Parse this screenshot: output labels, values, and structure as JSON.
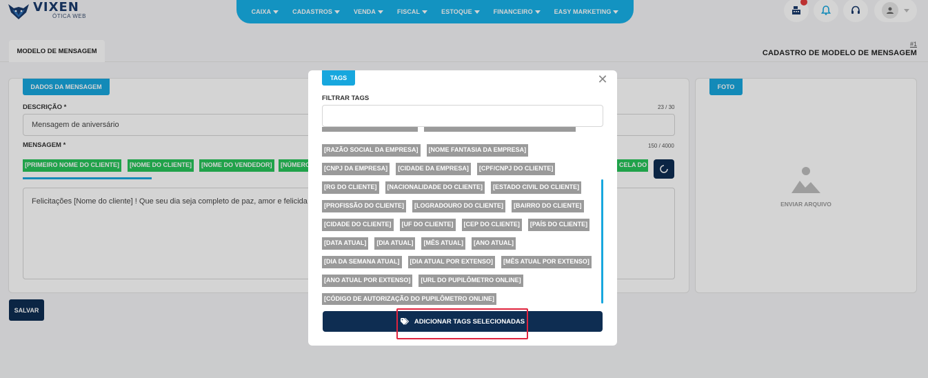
{
  "brand": {
    "name": "VIXEN",
    "sub": "ÓTICA WEB"
  },
  "nav": [
    {
      "label": "CAIXA"
    },
    {
      "label": "CADASTROS"
    },
    {
      "label": "VENDA"
    },
    {
      "label": "FISCAL"
    },
    {
      "label": "ESTOQUE"
    },
    {
      "label": "FINANCEIRO"
    },
    {
      "label": "EASY MARKETING"
    }
  ],
  "header_icons": [
    "cash-register-icon",
    "bell-icon",
    "headset-icon",
    "user-icon"
  ],
  "colors": {
    "accent": "#17b1e8",
    "dark": "#0e2d52",
    "green_tag": "#27c35a",
    "gray_tag": "#9a9a9a",
    "highlight": "#e0233d"
  },
  "page": {
    "tab": "MODELO DE MENSAGEM",
    "record_number": "#1",
    "title": "CADASTRO DE MODELO DE MENSAGEM"
  },
  "form": {
    "section": "DADOS DA MENSAGEM",
    "description_label": "DESCRIÇÃO *",
    "description_counter": "23 / 30",
    "description_value": "Mensagem de aniversário",
    "message_label": "MENSAGEM *",
    "message_counter": "150 / 4000",
    "message_tags": [
      "[PRIMEIRO NOME DO CLIENTE]",
      "[NOME DO CLIENTE]",
      "[NOME DO VENDEDOR]",
      "[NÚMERO",
      "CELA DO C"
    ],
    "message_value": "Felicitações [Nome do cliente] ! Que seu dia seja completo de paz, amor e felicida",
    "save_label": "SALVAR"
  },
  "photo": {
    "section": "FOTO",
    "upload_label": "ENVIAR ARQUIVO"
  },
  "modal": {
    "tag": "TAGS",
    "filter_label": "FILTRAR TAGS",
    "filter_value": "",
    "tag_rows": [
      [
        "[RAZÃO SOCIAL DA EMPRESA]",
        "[NOME FANTASIA DA EMPRESA]"
      ],
      [
        "[CNPJ DA EMPRESA]",
        "[CIDADE DA EMPRESA]",
        "[CPF/CNPJ DO CLIENTE]"
      ],
      [
        "[RG DO CLIENTE]",
        "[NACIONALIDADE DO CLIENTE]",
        "[ESTADO CIVIL DO CLIENTE]"
      ],
      [
        "[PROFISSÃO DO CLIENTE]",
        "[LOGRADOURO DO CLIENTE]",
        "[BAIRRO DO CLIENTE]"
      ],
      [
        "[CIDADE DO CLIENTE]",
        "[UF DO CLIENTE]",
        "[CEP DO CLIENTE]",
        "[PAÍS DO CLIENTE]"
      ],
      [
        "[DATA ATUAL]",
        "[DIA ATUAL]",
        "[MÊS ATUAL]",
        "[ANO ATUAL]"
      ],
      [
        "[DIA DA SEMANA ATUAL]",
        "[DIA ATUAL POR EXTENSO]",
        "[MÊS ATUAL POR EXTENSO]"
      ],
      [
        "[ANO ATUAL POR EXTENSO]",
        "[URL DO PUPILÔMETRO ONLINE]"
      ],
      [
        "[CÓDIGO DE AUTORIZAÇÃO DO PUPILÔMETRO ONLINE]"
      ]
    ],
    "add_button_label": "ADICIONAR TAGS SELECIONADAS"
  }
}
